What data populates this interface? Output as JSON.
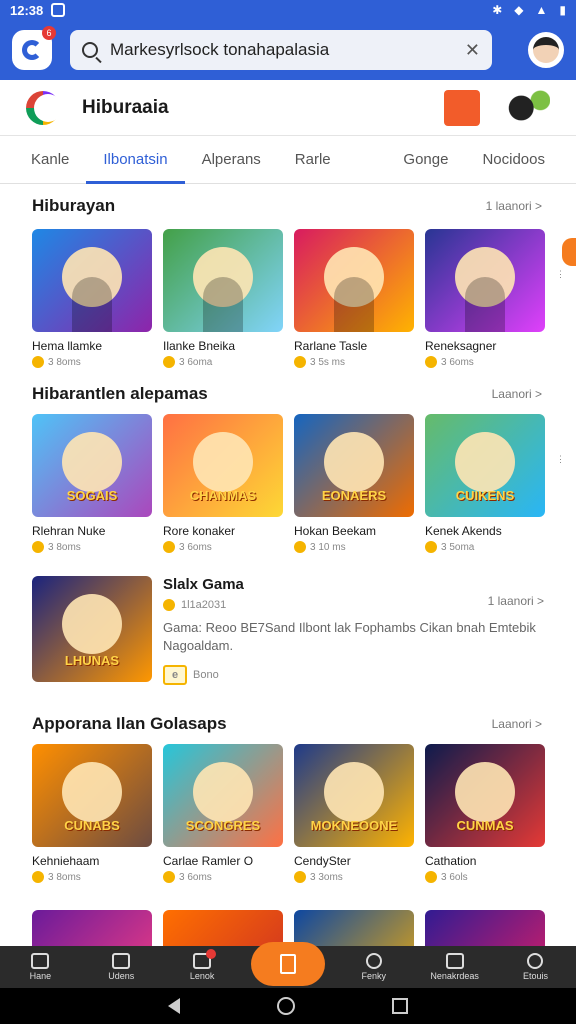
{
  "status_bar": {
    "time": "12:38"
  },
  "search": {
    "value": "Markesyrlsock tonahapalasia",
    "clear_icon": "clear-icon"
  },
  "app": {
    "badge": "6"
  },
  "brand": {
    "title": "Hiburaaia"
  },
  "tabs": [
    {
      "label": "Kanle",
      "active": false
    },
    {
      "label": "Ilbonatsin",
      "active": true
    },
    {
      "label": "Alperans",
      "active": false
    },
    {
      "label": "Rarle",
      "active": false
    },
    {
      "label": "Gonge",
      "active": false
    },
    {
      "label": "Nocidoos",
      "active": false
    }
  ],
  "sections": [
    {
      "title": "Hiburayan",
      "more": "1 laanori >",
      "items": [
        {
          "name": "Hema llamke",
          "rating": "3 8oms",
          "color_a": "#1e88e5",
          "color_b": "#8e24aa"
        },
        {
          "name": "Ilanke Bneika",
          "rating": "3 6oma",
          "color_a": "#43a047",
          "color_b": "#81d4fa"
        },
        {
          "name": "Rarlane Tasle",
          "rating": "3 5s ms",
          "color_a": "#d81b60",
          "color_b": "#ffb300"
        },
        {
          "name": "Reneksagner",
          "rating": "3 6oms",
          "color_a": "#283593",
          "color_b": "#e040fb"
        }
      ]
    },
    {
      "title": "Hibarantlen alepamas",
      "more": "Laanori >",
      "items": [
        {
          "name": "Rlehran Nuke",
          "rating": "3 8oms",
          "color_a": "#4fc3f7",
          "color_b": "#ab47bc",
          "art_text": "SOGAIS"
        },
        {
          "name": "Rore konaker",
          "rating": "3 6oms",
          "color_a": "#ff7043",
          "color_b": "#fdd835",
          "art_text": "CHANMAS"
        },
        {
          "name": "Hokan Beekam",
          "rating": "3 10 ms",
          "color_a": "#1565c0",
          "color_b": "#ef6c00",
          "art_text": "EONAERS"
        },
        {
          "name": "Kenek Akends",
          "rating": "3 5oma",
          "color_a": "#66bb6a",
          "color_b": "#29b6f6",
          "art_text": "CUIKENS"
        }
      ]
    },
    {
      "title": "Apporana Ilan Golasaps",
      "more": "Laanori >",
      "items": [
        {
          "name": "Kehniehaam",
          "rating": "3 8oms",
          "color_a": "#ff8f00",
          "color_b": "#6d4c41",
          "art_text": "CUNABS"
        },
        {
          "name": "Carlae Ramler O",
          "rating": "3 6oms",
          "color_a": "#26c6da",
          "color_b": "#ff7043",
          "art_text": "SCONGRES"
        },
        {
          "name": "CendySter",
          "rating": "3 3oms",
          "color_a": "#1e3a8a",
          "color_b": "#ffb300",
          "art_text": "MOKNEOONE"
        },
        {
          "name": "Cathation",
          "rating": "3 6ols",
          "color_a": "#0d1b4d",
          "color_b": "#e53935",
          "art_text": "CUNMAS"
        }
      ]
    }
  ],
  "feature": {
    "title": "Slalx Gama",
    "meta": "1l1a2031",
    "description": "Gama: Reoo BE7Sand Ilbont lak Fophambs Cikan bnah Emtebik Nagoaldam.",
    "tag_icon": "e",
    "tag_text": "Bono",
    "more": "1 laanori >",
    "color_a": "#1a237e",
    "color_b": "#ff9800",
    "art_text": "LHUNAS"
  },
  "bottom_nav": [
    {
      "label": "Hane",
      "icon": "home-icon"
    },
    {
      "label": "Udens",
      "icon": "list-icon"
    },
    {
      "label": "Lenok",
      "icon": "chat-icon"
    },
    {
      "label": "",
      "icon": "center-icon"
    },
    {
      "label": "Fenky",
      "icon": "search-icon"
    },
    {
      "label": "Nenakrdeas",
      "icon": "gallery-icon"
    },
    {
      "label": "Etouis",
      "icon": "profile-icon"
    }
  ],
  "colors": {
    "primary": "#2f5fd6",
    "accent": "#f57c1f"
  }
}
